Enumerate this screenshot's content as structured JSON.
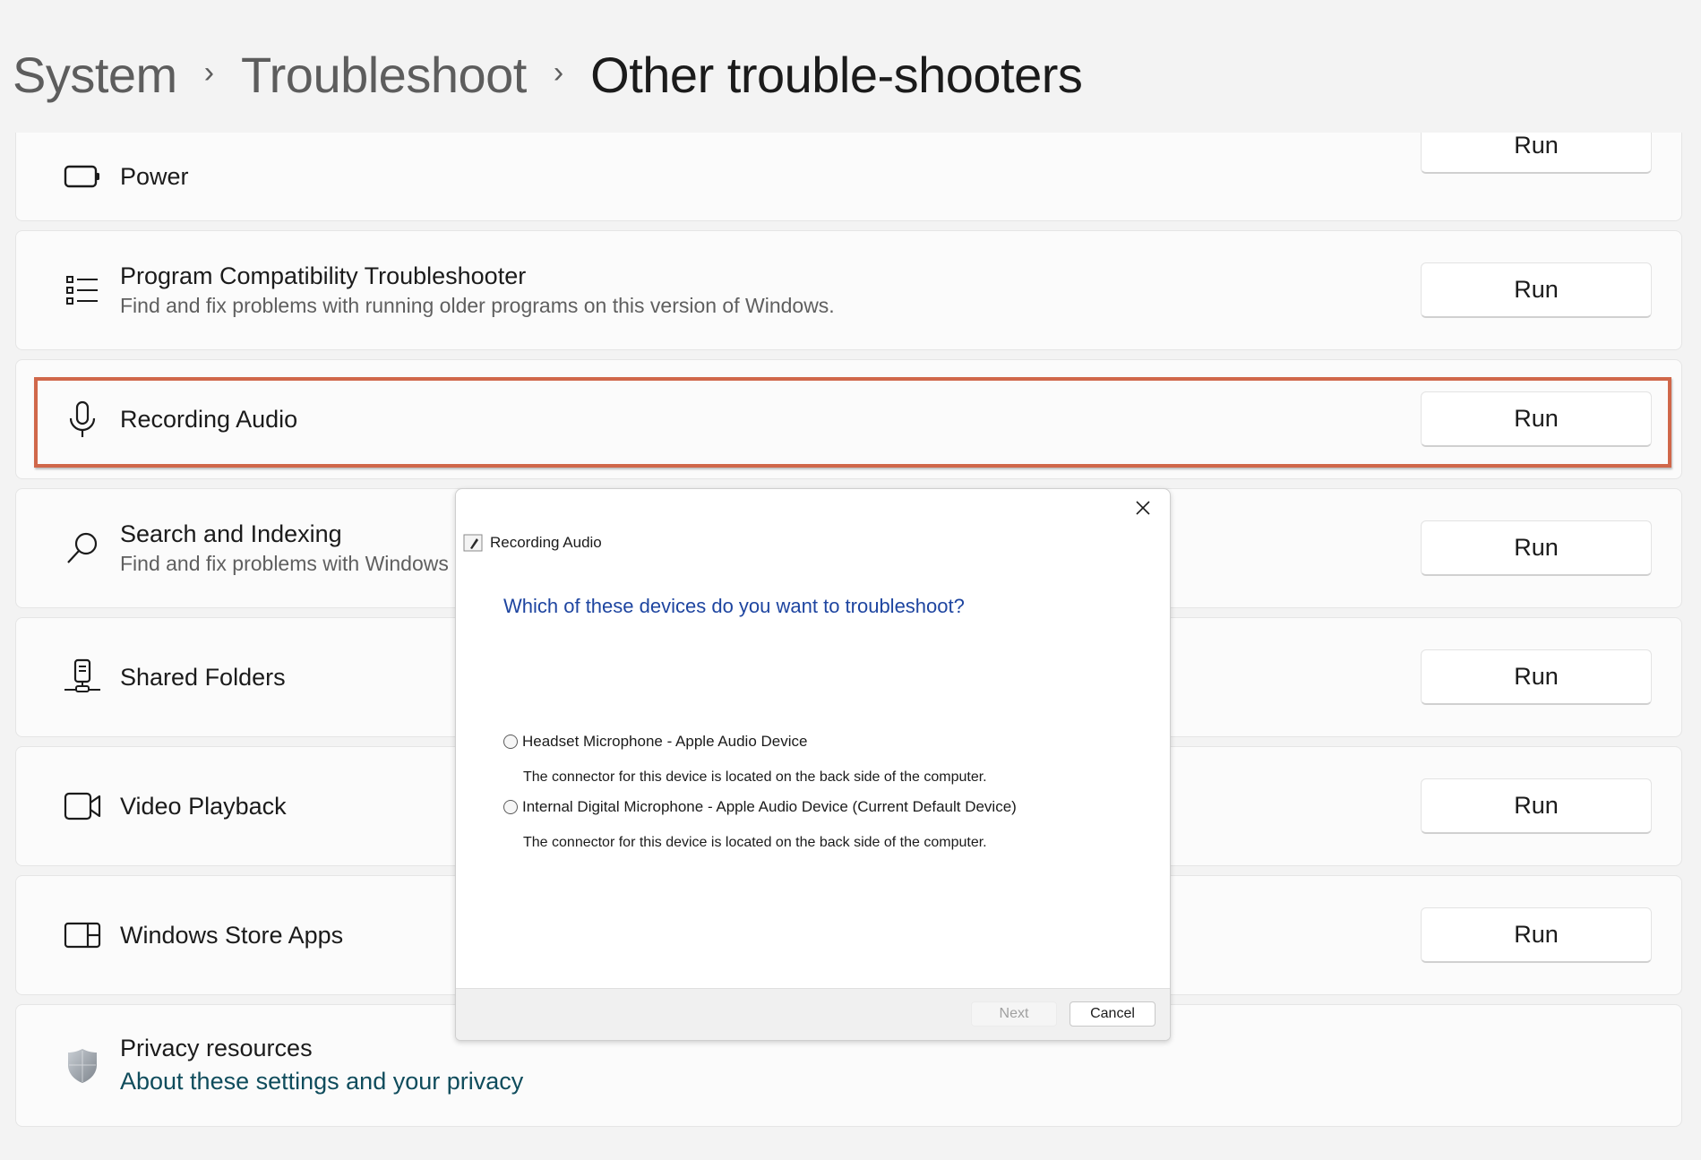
{
  "breadcrumb": {
    "items": [
      "System",
      "Troubleshoot"
    ],
    "separator": "›",
    "current": "Other trouble-shooters"
  },
  "troubleshooters": [
    {
      "icon": "battery-icon",
      "title": "Power",
      "description": "",
      "button": "Run"
    },
    {
      "icon": "list-icon",
      "title": "Program Compatibility Troubleshooter",
      "description": "Find and fix problems with running older programs on this version of Windows.",
      "button": "Run"
    },
    {
      "icon": "microphone-icon",
      "title": "Recording Audio",
      "description": "",
      "button": "Run",
      "highlighted": true
    },
    {
      "icon": "search-icon",
      "title": "Search and Indexing",
      "description": "Find and fix problems with Windows",
      "button": "Run"
    },
    {
      "icon": "network-drive-icon",
      "title": "Shared Folders",
      "description": "",
      "button": "Run"
    },
    {
      "icon": "video-camera-icon",
      "title": "Video Playback",
      "description": "",
      "button": "Run"
    },
    {
      "icon": "store-apps-icon",
      "title": "Windows Store Apps",
      "description": "",
      "button": "Run"
    }
  ],
  "privacy": {
    "icon": "shield-icon",
    "title": "Privacy resources",
    "link": "About these settings and your privacy"
  },
  "highlight_color": "#D0674A",
  "dialog": {
    "title": "Recording Audio",
    "close_icon": "close-icon",
    "heading": "Which of these devices do you want to troubleshoot?",
    "options": [
      {
        "label": "Headset Microphone - Apple Audio Device",
        "description": "The connector for this device is located on the back side of the computer.",
        "selected": false
      },
      {
        "label": "Internal Digital Microphone - Apple Audio Device (Current Default Device)",
        "description": "The connector for this device is located on the back side of the computer.",
        "selected": false
      }
    ],
    "next_label": "Next",
    "next_enabled": false,
    "cancel_label": "Cancel"
  }
}
